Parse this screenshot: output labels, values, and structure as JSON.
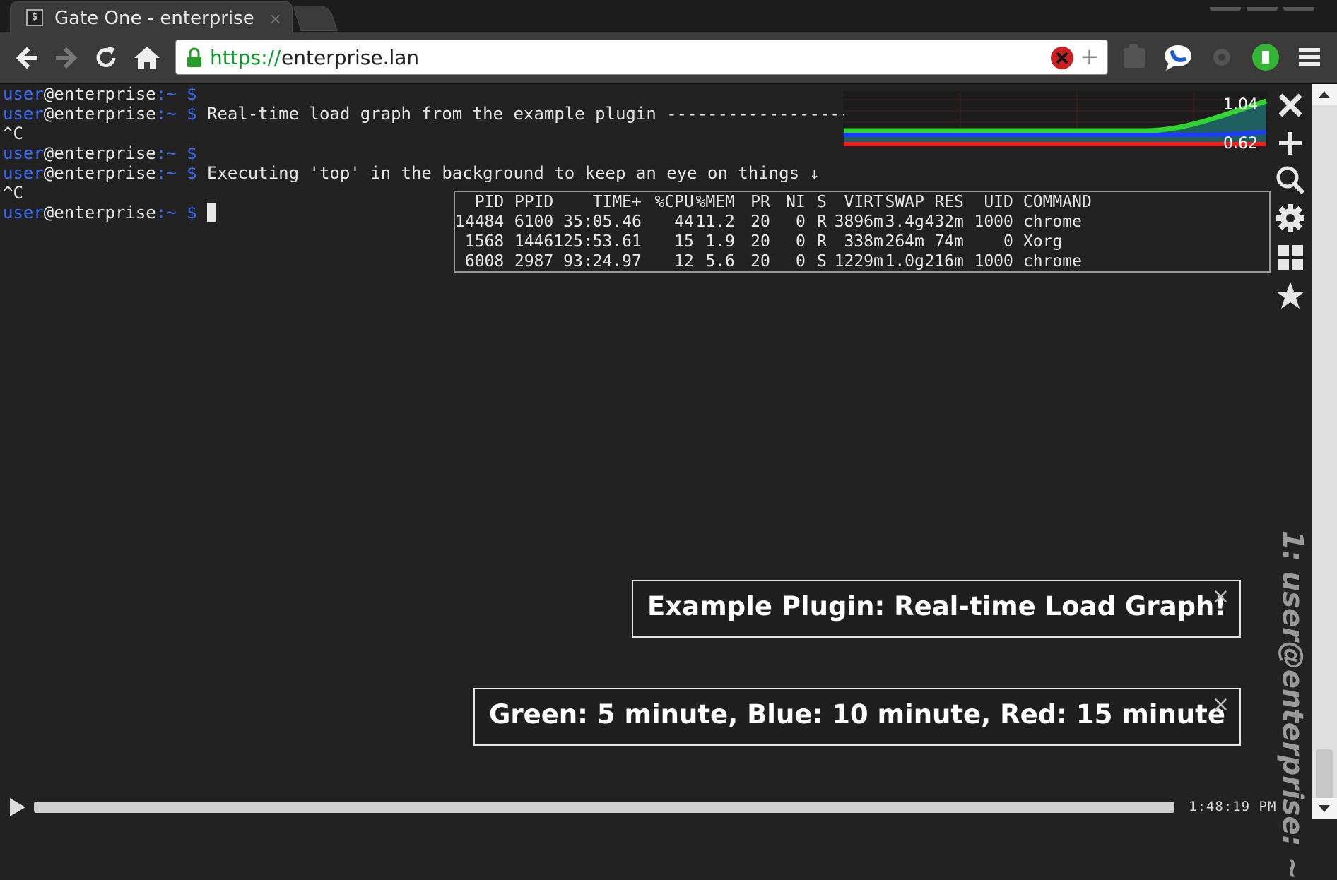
{
  "browser": {
    "tab_title": "Gate One - enterprise",
    "tab_close": "×",
    "tab_favicon": "$",
    "url_scheme": "https://",
    "url_host": "enterprise.lan"
  },
  "terminal": {
    "prompt_user": "user",
    "prompt_host": "@enterprise",
    "prompt_tail": ":~ $",
    "lines": [
      {
        "type": "prompt",
        "cmd": ""
      },
      {
        "type": "prompt",
        "cmd": " Real-time load graph from the example plugin ------------------>"
      },
      {
        "type": "text",
        "text": "^C"
      },
      {
        "type": "prompt",
        "cmd": ""
      },
      {
        "type": "prompt",
        "cmd": " Executing 'top' in the background to keep an eye on things ↓"
      },
      {
        "type": "text",
        "text": "^C"
      },
      {
        "type": "prompt",
        "cmd": " "
      }
    ]
  },
  "load_graph": {
    "max_label": "1.04",
    "min_label": "0.62",
    "colors": {
      "five_min": "#2fd62f",
      "ten_min": "#1e3cff",
      "fifteen_min": "#ff1a1a",
      "fill": "#1f5f5f"
    }
  },
  "top": {
    "headers": [
      "PID",
      "PPID",
      "TIME+",
      "%CPU",
      "%MEM",
      "PR",
      "NI",
      "S",
      "VIRT",
      "SWAP",
      "RES",
      "UID",
      "COMMAND"
    ],
    "rows": [
      [
        "14484",
        "6100",
        "35:05.46",
        "44",
        "11.2",
        "20",
        "0",
        "R",
        "3896m",
        "3.4g",
        "432m",
        "1000",
        "chrome"
      ],
      [
        "1568",
        "1446",
        "125:53.61",
        "15",
        "1.9",
        "20",
        "0",
        "R",
        "338m",
        "264m",
        "74m",
        "0",
        "Xorg"
      ],
      [
        "6008",
        "2987",
        "93:24.97",
        "12",
        "5.6",
        "20",
        "0",
        "S",
        "1229m",
        "1.0g",
        "216m",
        "1000",
        "chrome"
      ]
    ]
  },
  "notifications": [
    {
      "message": "Example Plugin: Real-time Load Graph!",
      "close": "×"
    },
    {
      "message": "Green: 5 minute, Blue: 10 minute, Red: 15 minute",
      "close": "×"
    }
  ],
  "playback": {
    "clock": "1:48:19 PM"
  },
  "workspace": {
    "title": "1: user@enterprise: ~"
  }
}
